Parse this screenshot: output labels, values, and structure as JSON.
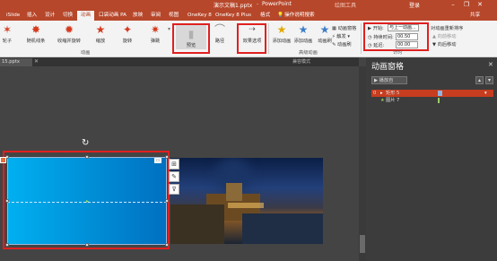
{
  "titlebar": {
    "filename": "演示文稿1.pptx",
    "app": "PowerPoint",
    "contextual": "绘图工具",
    "user": "登录",
    "minimize_icon": "minimize-icon",
    "restore_icon": "restore-icon",
    "close_icon": "close-icon",
    "brand_color": "#b7472a"
  },
  "tabs": {
    "items": [
      "iSlide",
      "插入",
      "设计",
      "切换",
      "动画",
      "口袋动画 PA",
      "放映",
      "审阅",
      "视图",
      "OneKey 8",
      "OneKey 8 Plus",
      "格式"
    ],
    "active": "动画",
    "tell_me": "操作说明搜索",
    "share": "共享"
  },
  "ribbon": {
    "effects": [
      "轮子",
      "随机线条",
      "收缩并旋转",
      "缩放",
      "旋转",
      "弹跳"
    ],
    "preview_label": "预览",
    "path_label": "路径",
    "effect_options": "效果选项",
    "add_animation": "添加动画",
    "animation_pane": "动画窗格",
    "add_animation_label": "添加动画",
    "animation_brush": "动画刷",
    "trigger": "触发",
    "animation_group": "动画",
    "advanced_group": "高级动画",
    "timing_group": "计时",
    "start_label": "开始:",
    "start_value": "与上一动画...",
    "duration_label": "持续时间:",
    "duration_value": "00.50",
    "delay_label": "延迟:",
    "delay_value": "00.00",
    "reorder_title": "对动画重新排序",
    "move_earlier": "向前移动",
    "move_later": "向后移动"
  },
  "document": {
    "tab_name": "15.pptx",
    "mode": "兼容模式"
  },
  "pane": {
    "title": "动画窗格",
    "play_label": "播放自",
    "items": [
      {
        "num": "0",
        "label": "矩形 5",
        "color": "#8fb4e0"
      },
      {
        "num": "",
        "label": "图片 7",
        "color": "#9ccc65"
      }
    ]
  },
  "slide": {
    "rotate_icon": "rotate-handle-icon"
  }
}
